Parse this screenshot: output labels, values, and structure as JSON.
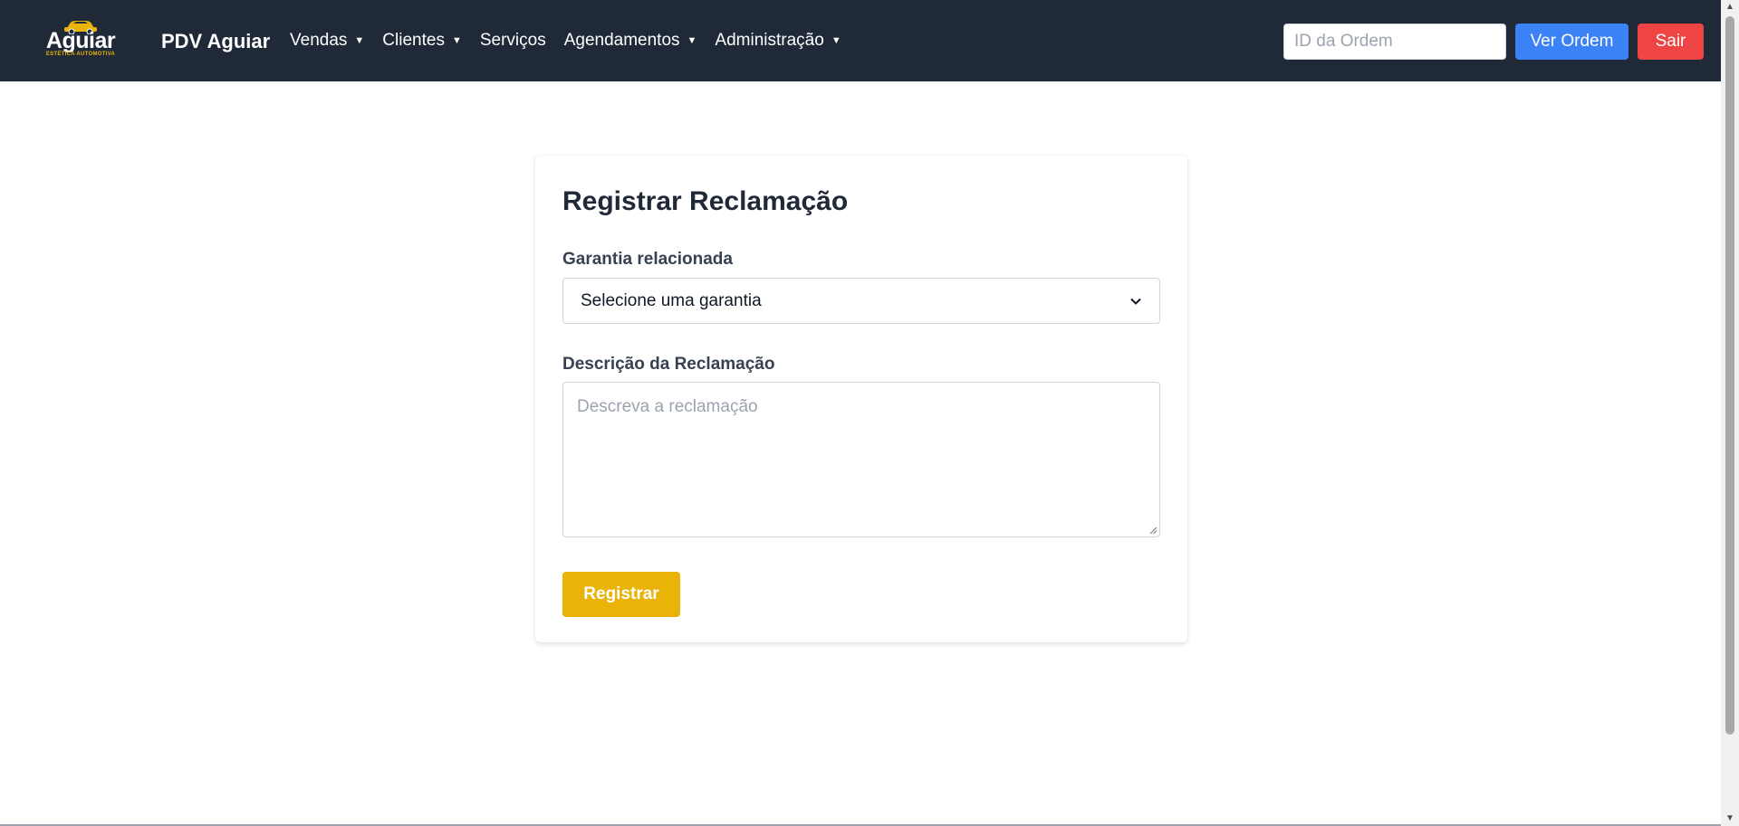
{
  "header": {
    "logo": {
      "word": "Aguiar",
      "subtitle": "ESTÉTICA AUTOMOTIVA",
      "icon": "car-icon"
    },
    "brand": "PDV Aguiar",
    "menu": [
      {
        "label": "Vendas",
        "dropdown": true
      },
      {
        "label": "Clientes",
        "dropdown": true
      },
      {
        "label": "Serviços",
        "dropdown": false
      },
      {
        "label": "Agendamentos",
        "dropdown": true
      },
      {
        "label": "Administração",
        "dropdown": true
      }
    ],
    "caret": "▼",
    "order_search": {
      "placeholder": "ID da Ordem",
      "value": ""
    },
    "view_order_label": "Ver Ordem",
    "logout_label": "Sair"
  },
  "form": {
    "title": "Registrar Reclamação",
    "warranty_label": "Garantia relacionada",
    "warranty_selected": "Selecione uma garantia",
    "description_label": "Descrição da Reclamação",
    "description_placeholder": "Descreva a reclamação",
    "description_value": "",
    "submit_label": "Registrar"
  },
  "colors": {
    "navbar": "#1f2937",
    "primary_blue": "#3b82f6",
    "danger_red": "#ef4444",
    "accent_yellow": "#eab308"
  }
}
